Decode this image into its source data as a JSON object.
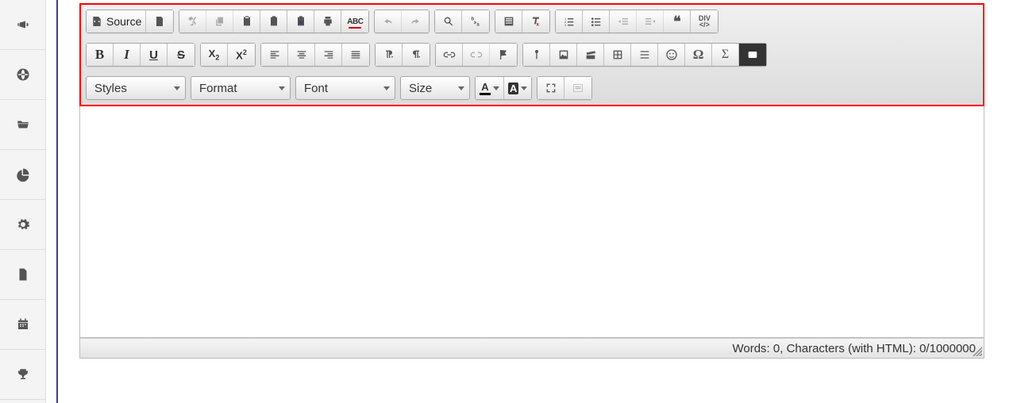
{
  "sidebar": {
    "items": [
      {
        "name": "announcements"
      },
      {
        "name": "globe"
      },
      {
        "name": "folder"
      },
      {
        "name": "chart"
      },
      {
        "name": "settings"
      },
      {
        "name": "document"
      },
      {
        "name": "calendar"
      },
      {
        "name": "trophy"
      }
    ]
  },
  "toolbar": {
    "source_label": "Source",
    "dropdowns": {
      "styles": "Styles",
      "format": "Format",
      "font": "Font",
      "size": "Size"
    },
    "spellcheck_label": "ABC",
    "div_label_top": "DIV",
    "div_label_bottom": "</>",
    "subscript": {
      "base": "X",
      "sub": "2"
    },
    "superscript": {
      "base": "X",
      "sup": "2"
    },
    "textcolor_letter": "A",
    "bgcolor_letter": "A"
  },
  "statusbar": {
    "text": "Words: 0, Characters (with HTML): 0/1000000"
  }
}
